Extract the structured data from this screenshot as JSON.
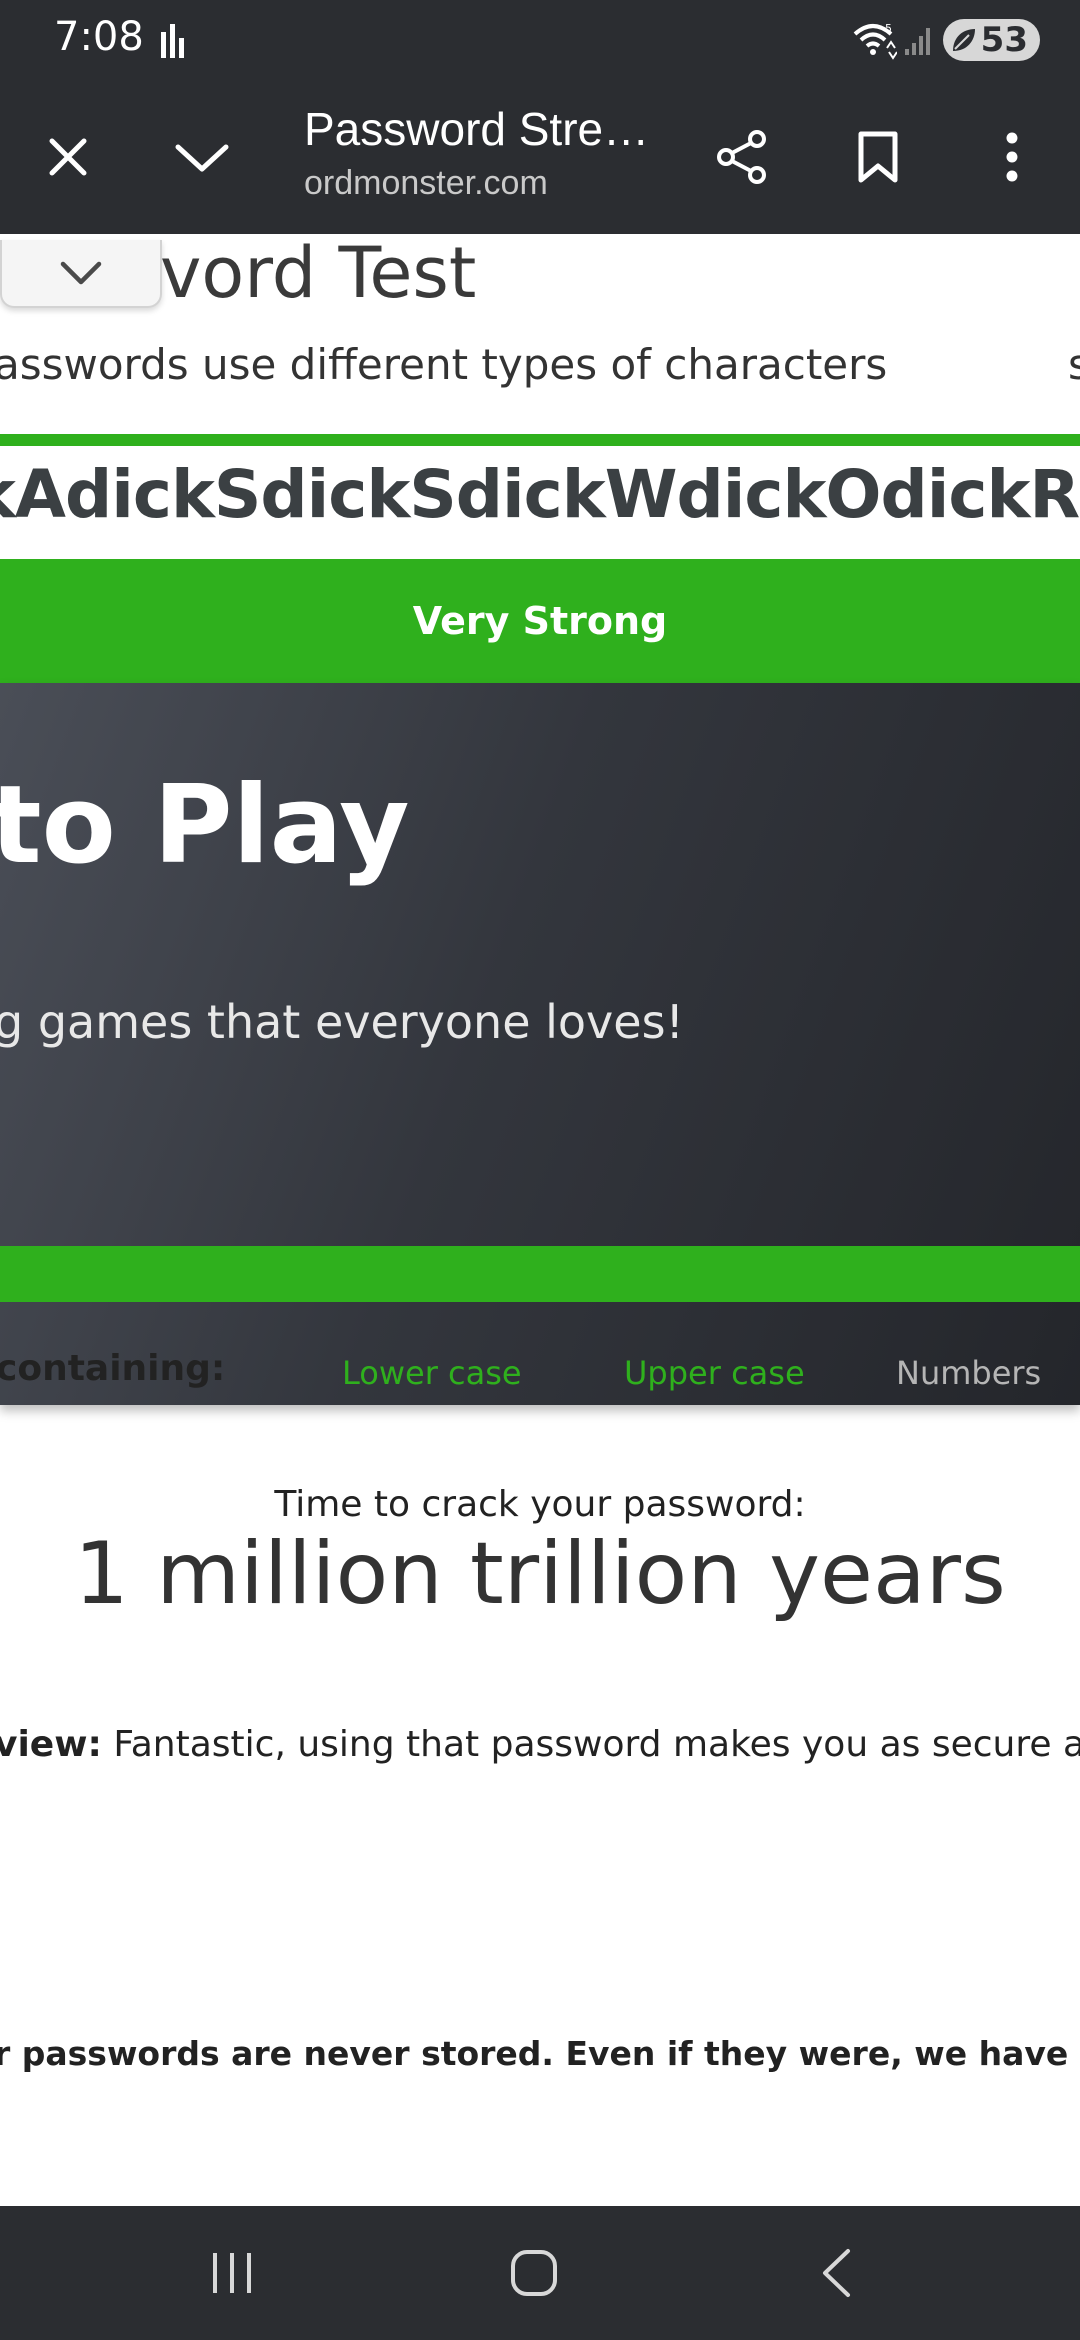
{
  "status_bar": {
    "time": "7:08",
    "network_label": "5",
    "battery": "53"
  },
  "browser": {
    "title": "Password Stre…",
    "url": "ordmonster.com"
  },
  "page": {
    "heading": "vord Test",
    "subtitle": "asswords use different types of characters",
    "subtitle_right": "s",
    "password": "kAdickSdickSdickWdickOdickRdickD",
    "strength": "Very Strong",
    "promo_title": "to Play",
    "promo_subtitle": "g games that everyone loves!",
    "containing_label": "containing:",
    "char_types": [
      {
        "label": "Lower case",
        "active": true
      },
      {
        "label": "Upper case",
        "active": true
      },
      {
        "label": "Numbers",
        "active": false
      }
    ],
    "crack_label": "Time to crack your password:",
    "crack_time": "1 million trillion years",
    "review_label": "view:",
    "review_text": "Fantastic, using that password makes you as secure as Fort Kno",
    "disclaimer": "r passwords are never stored. Even if they were, we have no idea who you a"
  },
  "colors": {
    "accent_green": "#2fb01d",
    "inactive_gray": "#b5b5b5",
    "chrome_dark": "#2b2d31"
  },
  "icons": {
    "close": "close-icon",
    "collapse": "chevron-down-icon",
    "share": "share-icon",
    "bookmark": "bookmark-icon",
    "menu": "more-vert-icon",
    "nav_recents": "recents-icon",
    "nav_home": "home-icon",
    "nav_back": "back-icon"
  }
}
